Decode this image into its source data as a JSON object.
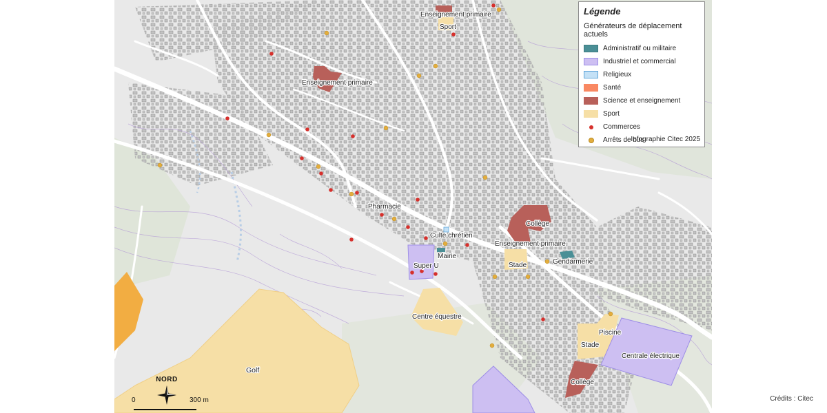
{
  "legend": {
    "title": "Légende",
    "subtitle": "Générateurs de déplacement actuels",
    "items": [
      {
        "label": "Administratif ou militaire",
        "color": "#4a8f96",
        "border": "#3c7a80",
        "kind": "area"
      },
      {
        "label": "Industriel et commercial",
        "color": "#cdbff2",
        "border": "#9d8ee6",
        "kind": "area"
      },
      {
        "label": "Religieux",
        "color": "#c4e1f6",
        "border": "#5fa5d9",
        "kind": "area"
      },
      {
        "label": "Santé",
        "color": "#f98862",
        "border": "#f98862",
        "kind": "area"
      },
      {
        "label": "Science et enseignement",
        "color": "#b8605a",
        "border": "#b8605a",
        "kind": "area"
      },
      {
        "label": "Sport",
        "color": "#f6dfa6",
        "border": "#f6dfa6",
        "kind": "area"
      },
      {
        "label": "Commerces",
        "color": "#d6302c",
        "kind": "dot"
      },
      {
        "label": "Arrêts de bus",
        "color": "#e3ad3c",
        "kind": "dot"
      }
    ],
    "credit": "Infographie Citec 2025"
  },
  "map_labels": [
    {
      "text": "Enseignement primaire",
      "category": "Science et enseignement"
    },
    {
      "text": "Sport",
      "category": "Sport"
    },
    {
      "text": "Enseignement primaire",
      "category": "Science et enseignement"
    },
    {
      "text": "Pharmacie",
      "category": "Santé"
    },
    {
      "text": "Culte chrétien",
      "category": "Religieux"
    },
    {
      "text": "Mairie",
      "category": "Administratif ou militaire"
    },
    {
      "text": "Super U",
      "category": "Industriel et commercial"
    },
    {
      "text": "Collège",
      "category": "Science et enseignement"
    },
    {
      "text": "Enseignement primaire",
      "category": "Science et enseignement"
    },
    {
      "text": "Stade",
      "category": "Sport"
    },
    {
      "text": "Gendarmerie",
      "category": "Administratif ou militaire"
    },
    {
      "text": "Centre équestre",
      "category": "Sport"
    },
    {
      "text": "Piscine",
      "category": "Sport"
    },
    {
      "text": "Stade",
      "category": "Sport"
    },
    {
      "text": "Centrale électrique",
      "category": "Industriel et commercial"
    },
    {
      "text": "Collège",
      "category": "Science et enseignement"
    },
    {
      "text": "Golf",
      "category": "Sport"
    }
  ],
  "scale": {
    "zero": "0",
    "distance": "300 m"
  },
  "north": {
    "label": "NORD",
    "icon": "compass-rose-icon"
  },
  "credits": "Crédits : Citec"
}
